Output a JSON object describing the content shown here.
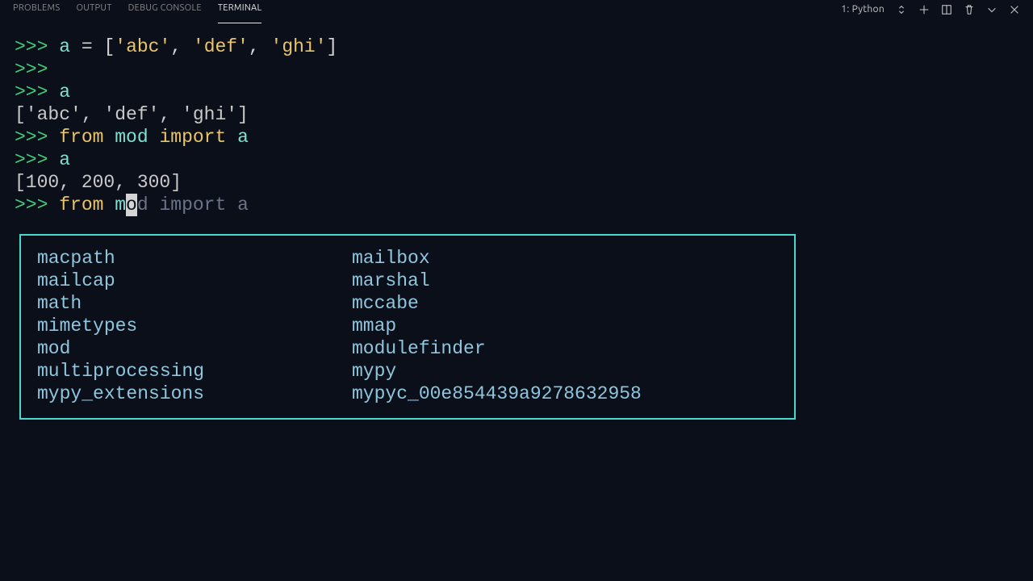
{
  "panel": {
    "tabs": [
      "PROBLEMS",
      "OUTPUT",
      "DEBUG CONSOLE",
      "TERMINAL"
    ],
    "active_tab_index": 3,
    "session": "1: Python"
  },
  "terminal_lines": [
    {
      "prompt": ">>> ",
      "segments": [
        {
          "t": "ident",
          "v": "a"
        },
        {
          "t": "op",
          "v": " = "
        },
        {
          "t": "op",
          "v": "["
        },
        {
          "t": "str",
          "v": "'abc'"
        },
        {
          "t": "op",
          "v": ", "
        },
        {
          "t": "str",
          "v": "'def'"
        },
        {
          "t": "op",
          "v": ", "
        },
        {
          "t": "str",
          "v": "'ghi'"
        },
        {
          "t": "op",
          "v": "]"
        }
      ]
    },
    {
      "prompt": ">>> ",
      "segments": []
    },
    {
      "prompt": ">>> ",
      "segments": [
        {
          "t": "ident",
          "v": "a"
        }
      ]
    },
    {
      "out": "['abc', 'def', 'ghi']"
    },
    {
      "prompt": ">>> ",
      "segments": [
        {
          "t": "kw",
          "v": "from "
        },
        {
          "t": "ident",
          "v": "mod"
        },
        {
          "t": "kw",
          "v": " import "
        },
        {
          "t": "ident",
          "v": "a"
        }
      ]
    },
    {
      "prompt": ">>> ",
      "segments": [
        {
          "t": "ident",
          "v": "a"
        }
      ]
    },
    {
      "out": "[100, 200, 300]"
    }
  ],
  "current_input": {
    "prompt": ">>> ",
    "before_cursor": [
      {
        "t": "kw",
        "v": "from "
      },
      {
        "t": "ident",
        "v": "m"
      }
    ],
    "cursor_char": "o",
    "ghost_after": "d import a"
  },
  "completion": {
    "col1": [
      "macpath",
      "mailcap",
      "math",
      "mimetypes",
      "mod",
      "multiprocessing",
      "mypy_extensions"
    ],
    "col2": [
      "mailbox",
      "marshal",
      "mccabe",
      "mmap",
      "modulefinder",
      "mypy",
      "mypyc_00e854439a9278632958"
    ]
  }
}
